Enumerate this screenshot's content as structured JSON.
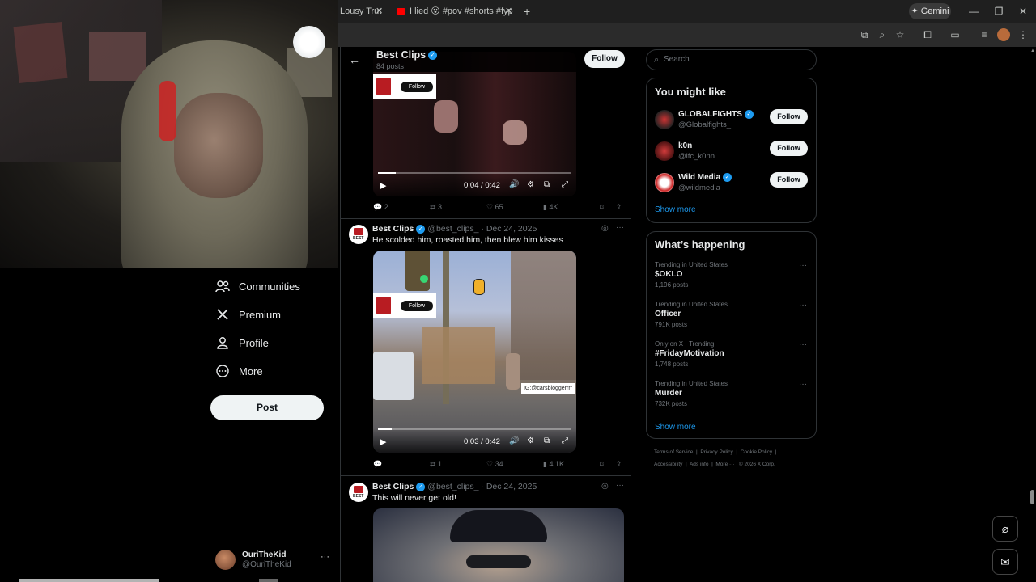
{
  "browser": {
    "tabs": [
      {
        "title": "Lousy Trut",
        "close": "✕"
      },
      {
        "title": "I lied 😮 #pov #shorts #fyp #su",
        "close": "✕"
      }
    ],
    "new_tab": "+",
    "gemini_label": "Gemini",
    "window": {
      "min": "—",
      "max": "❐",
      "close": "✕"
    }
  },
  "nav": {
    "items": [
      {
        "label": "Communities",
        "icon": "communities-icon"
      },
      {
        "label": "Premium",
        "icon": "x-logo-icon"
      },
      {
        "label": "Profile",
        "icon": "person-icon"
      },
      {
        "label": "More",
        "icon": "more-circle-icon"
      }
    ],
    "post_button": "Post",
    "account": {
      "name": "OuriTheKid",
      "handle": "@OuriTheKid",
      "menu": "···"
    }
  },
  "profile_header": {
    "name": "Best Clips",
    "posts_count": "84 posts",
    "follow_label": "Follow"
  },
  "posts": [
    {
      "video": {
        "time": "0:04 / 0:42",
        "progress": 0.09,
        "watermark_follow": "Follow"
      },
      "stats": {
        "replies": "2",
        "reposts": "3",
        "likes": "65",
        "views": "4K"
      }
    },
    {
      "author": "Best Clips",
      "handle": "@best_clips_",
      "date": "· Dec 24, 2025",
      "text": "He scolded him, roasted him, then blew him kisses",
      "video": {
        "time": "0:03 / 0:42",
        "progress": 0.07,
        "watermark_follow": "Follow",
        "overlay_text": "IG:@carsbloggerrrr"
      },
      "stats": {
        "replies": "",
        "reposts": "1",
        "likes": "34",
        "views": "4.1K"
      }
    },
    {
      "author": "Best Clips",
      "handle": "@best_clips_",
      "date": "· Dec 24, 2025",
      "text": "This will never get old!"
    }
  ],
  "avatar_text": "BEST",
  "search": {
    "placeholder": "Search"
  },
  "who_to_follow": {
    "title": "You might like",
    "users": [
      {
        "name": "GLOBALFIGHTS",
        "handle": "@Globalfights_",
        "verified": true,
        "button": "Follow"
      },
      {
        "name": "k0n",
        "handle": "@lfc_k0nn",
        "verified": false,
        "button": "Follow"
      },
      {
        "name": "Wild Media",
        "handle": "@wildmedia",
        "verified": true,
        "button": "Follow"
      }
    ],
    "show_more": "Show more"
  },
  "trending": {
    "title": "What’s happening",
    "items": [
      {
        "context": "Trending in United States",
        "topic": "$OKLO",
        "posts": "1,196 posts"
      },
      {
        "context": "Trending in United States",
        "topic": "Officer",
        "posts": "791K posts"
      },
      {
        "context": "Only on X · Trending",
        "topic": "#FridayMotivation",
        "posts": "1,748 posts"
      },
      {
        "context": "Trending in United States",
        "topic": "Murder",
        "posts": "732K posts"
      }
    ],
    "show_more": "Show more",
    "menu": "···"
  },
  "footer": {
    "line1": [
      "Terms of Service",
      "Privacy Policy",
      "Cookie Policy"
    ],
    "line2": [
      "Accessibility",
      "Ads info",
      "More ···",
      "© 2026 X Corp."
    ]
  },
  "colors": {
    "accent": "#1d9bf0",
    "bg": "#000000",
    "border": "#2f3336"
  }
}
